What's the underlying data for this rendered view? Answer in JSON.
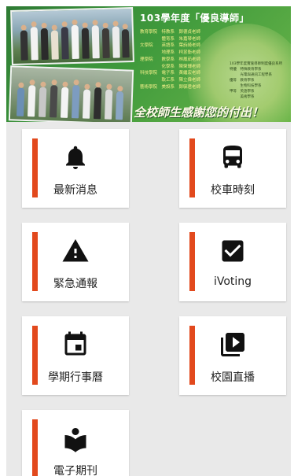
{
  "banner": {
    "title": "103學年度「優良導師」",
    "roster": [
      "教育學院　特教系　鄭德貞老師",
      "　　　　　體育系　朱嘉琴老師",
      "文學院　　英語系　葉詩綺老師",
      "　　　　　地理系　柯昱衡老師",
      "理學院　　數學系　林鳳茹老師",
      "　　　　　化學系　陳榮輝老師",
      "科技學院　電子系　黃繼宏老師",
      "　　　　　軟工系　陳立偉老師",
      "藝術學院　美設系　鄭毓君老師"
    ],
    "roster_note": [
      "103學年度實施導師制度優良系所",
      "特優　特殊教育學系",
      "　　　光電與通訊工程學系",
      "優等　教育學系",
      "　　　生物科技學系",
      "甲等　英語學系",
      "　　　美術學系"
    ],
    "slogan": "全校師生感謝您的付出！"
  },
  "tiles": [
    {
      "label": "最新消息",
      "icon": "bell-icon"
    },
    {
      "label": "校車時刻",
      "icon": "bus-icon"
    },
    {
      "label": "緊急通報",
      "icon": "warning-icon"
    },
    {
      "label": "iVoting",
      "icon": "checkbox-icon"
    },
    {
      "label": "學期行事曆",
      "icon": "calendar-icon"
    },
    {
      "label": "校園直播",
      "icon": "video-library-icon"
    },
    {
      "label": "電子期刊",
      "icon": "book-reader-icon"
    }
  ],
  "colors": {
    "accent_bar": "#e2491d",
    "background": "#e9e9e9",
    "tile": "#ffffff",
    "banner_green": "#3f9a3c"
  }
}
